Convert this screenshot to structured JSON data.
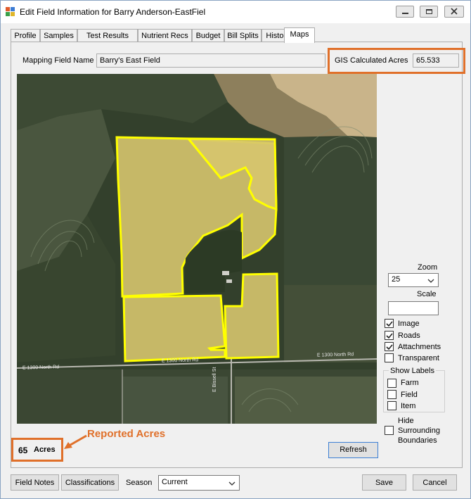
{
  "window": {
    "title": "Edit Field Information for Barry Anderson-EastFiel"
  },
  "tabs": [
    "Profile",
    "Samples",
    "Test Results",
    "Nutrient Recs",
    "Budget",
    "Bill Splits",
    "History",
    "Maps"
  ],
  "active_tab": "Maps",
  "mapping": {
    "field_name_label": "Mapping Field Name",
    "field_name_value": "Barry's East Field",
    "gis_label": "GIS Calculated Acres",
    "gis_value": "65.533"
  },
  "map": {
    "road_label_left": "E 1300 North Rd",
    "road_label_mid": "E 1300 North Rd",
    "road_label_right": "E 1300 North Rd",
    "road_label_vertical": "E Bissell St"
  },
  "controls": {
    "zoom_label": "Zoom",
    "zoom_value": "25",
    "scale_label": "Scale",
    "scale_value": "",
    "layers": [
      {
        "label": "Image",
        "checked": true
      },
      {
        "label": "Roads",
        "checked": true
      },
      {
        "label": "Attachments",
        "checked": true
      },
      {
        "label": "Transparent",
        "checked": false
      }
    ],
    "show_labels_title": "Show Labels",
    "labels": [
      {
        "label": "Farm",
        "checked": false
      },
      {
        "label": "Field",
        "checked": false
      },
      {
        "label": "Item",
        "checked": false
      }
    ],
    "hide_label_1": "Hide",
    "hide_label_2": "Surrounding",
    "hide_label_3": "Boundaries",
    "refresh": "Refresh"
  },
  "reported": {
    "acres_number": "65",
    "acres_unit": "Acres",
    "annotation": "Reported Acres"
  },
  "footer": {
    "field_notes": "Field Notes",
    "classifications": "Classifications",
    "season_label": "Season",
    "season_value": "Current",
    "save": "Save",
    "cancel": "Cancel"
  },
  "colors": {
    "highlight": "#e0702a",
    "boundary": "#ffff00",
    "field_fill": "#d6c56e"
  }
}
